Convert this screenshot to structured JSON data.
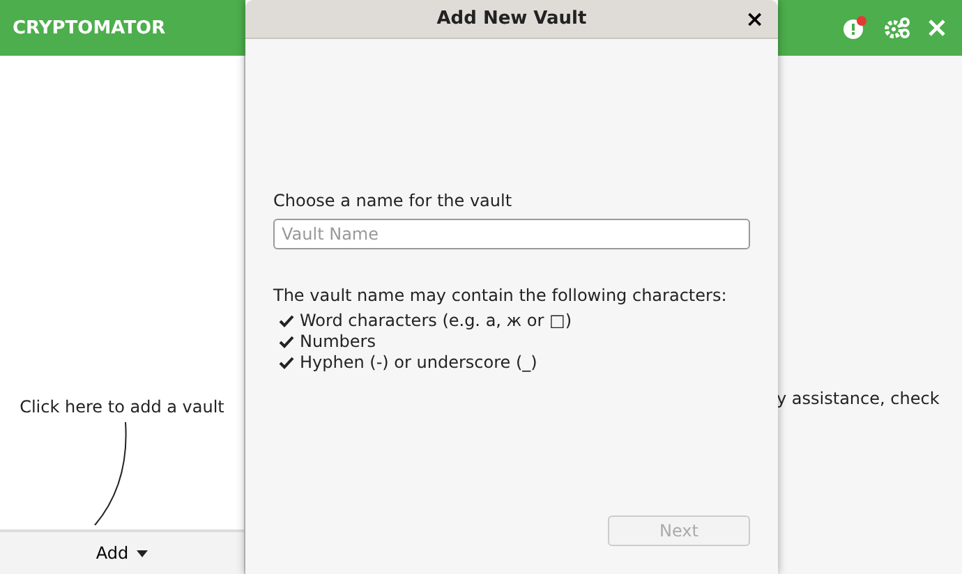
{
  "app": {
    "title": "CRYPTOMATOR",
    "hint": "Click here to add a vault",
    "add_button": "Add",
    "help_text": "y assistance, check",
    "update_available": true
  },
  "dialog": {
    "title": "Add New Vault",
    "close": "×",
    "name_label": "Choose a name for the vault",
    "name_field": {
      "placeholder": "Vault Name"
    },
    "rules_title": "The vault name may contain the following characters:",
    "rules": [
      "Word characters (e.g. a, ж or □)",
      "Numbers",
      "Hyphen (-) or underscore (_)"
    ],
    "next_button": {
      "label": "Next",
      "disabled": true
    }
  }
}
